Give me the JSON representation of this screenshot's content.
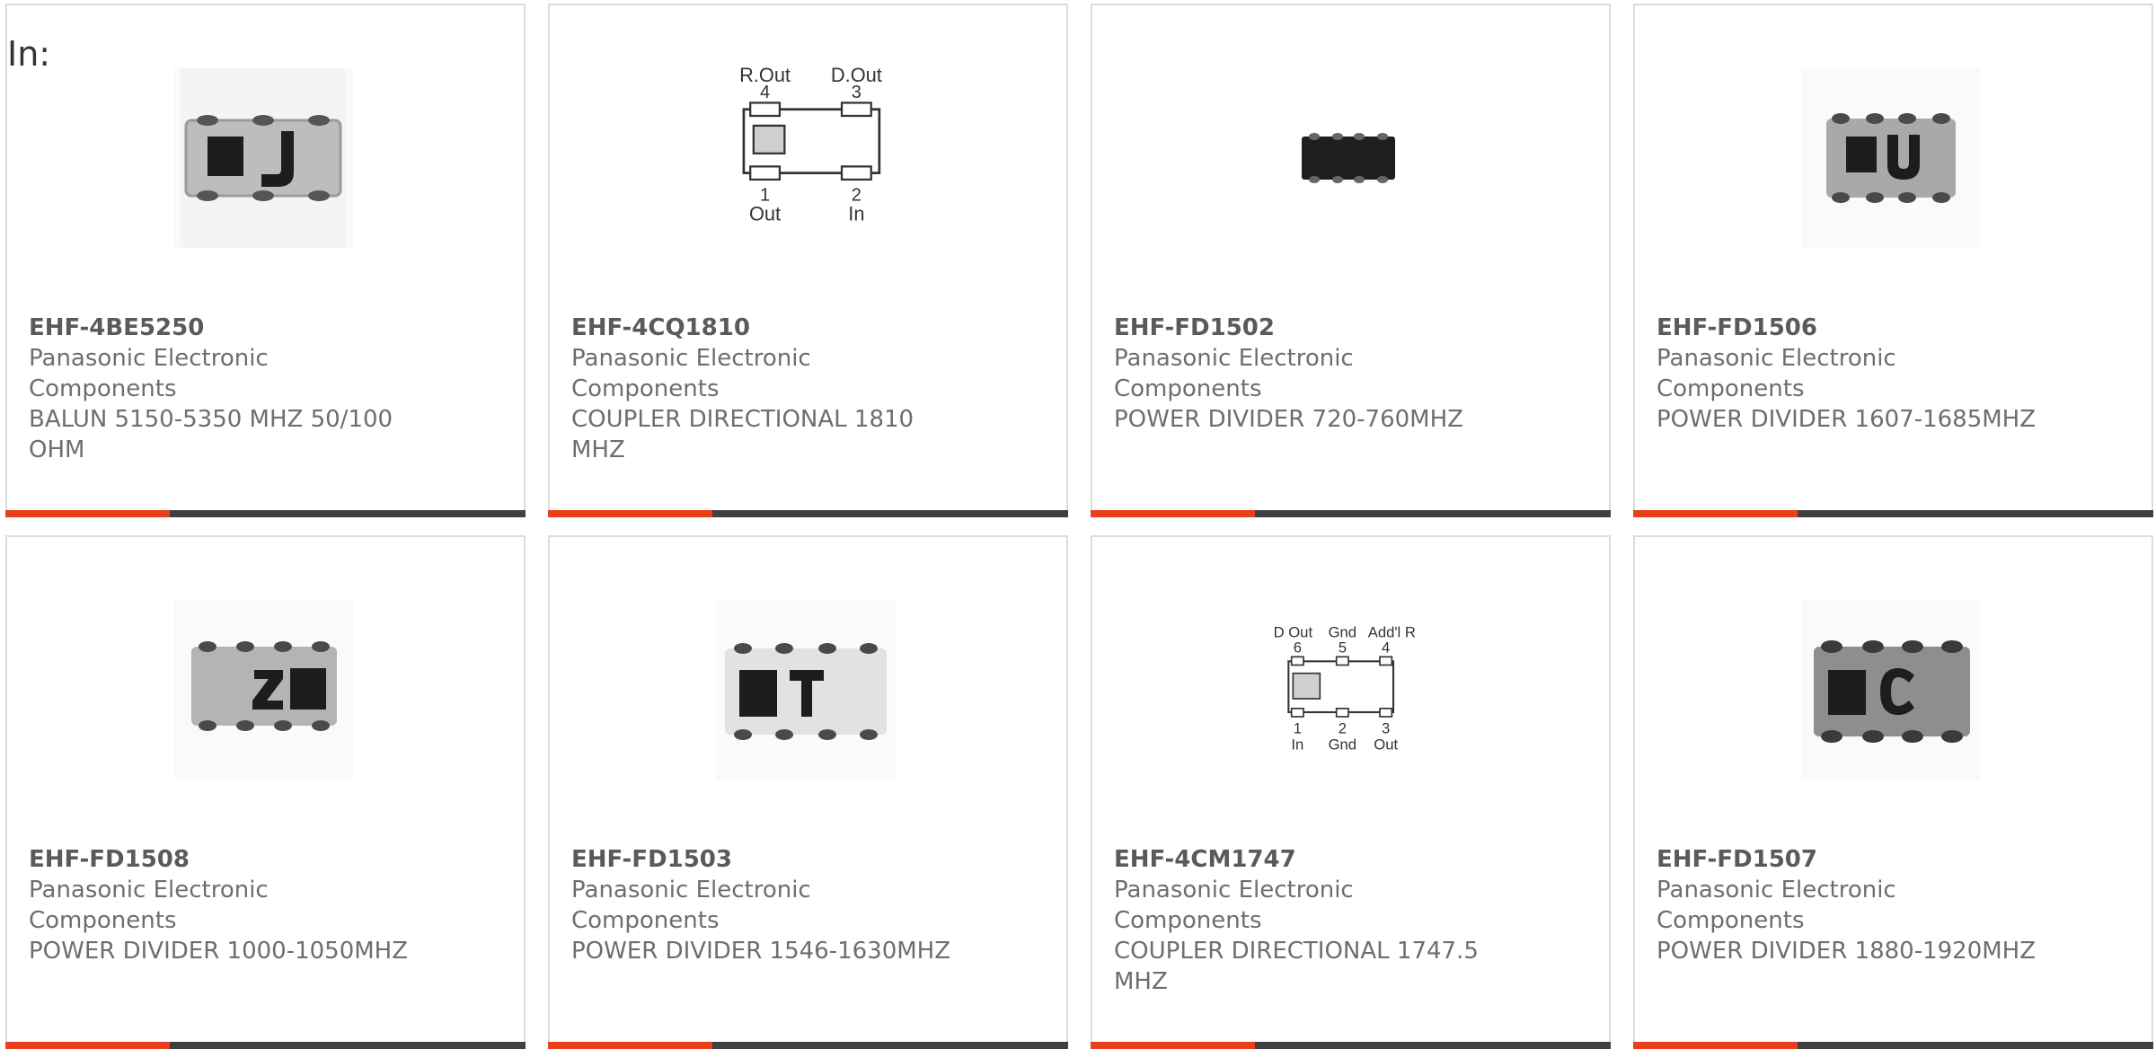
{
  "page": {
    "in_label": "In:"
  },
  "colors": {
    "accent": "#e8401c",
    "bar_rest": "#404040",
    "card_border": "#dcdcdc"
  },
  "products": [
    {
      "part": "EHF-4BE5250",
      "manufacturer": "Panasonic Electronic Components",
      "description": "BALUN 5150-5350 MHZ 50/100 OHM",
      "image": "chip-marked-J"
    },
    {
      "part": "EHF-4CQ1810",
      "manufacturer": "Panasonic Electronic Components",
      "description": "COUPLER DIRECTIONAL 1810 MHZ",
      "image": "coupler-pinout-diagram",
      "pins": {
        "p4": "4",
        "p3": "3",
        "p1": "1",
        "p2": "2",
        "l4": "R.Out",
        "l3": "D.Out",
        "l1": "Out",
        "l2": "In"
      }
    },
    {
      "part": "EHF-FD1502",
      "manufacturer": "Panasonic Electronic Components",
      "description": "POWER DIVIDER 720-760MHZ",
      "image": "chip-black"
    },
    {
      "part": "EHF-FD1506",
      "manufacturer": "Panasonic Electronic Components",
      "description": "POWER DIVIDER 1607-1685MHZ",
      "image": "chip-marked-U"
    },
    {
      "part": "EHF-FD1508",
      "manufacturer": "Panasonic Electronic Components",
      "description": "POWER DIVIDER 1000-1050MHZ",
      "image": "chip-marked-Z"
    },
    {
      "part": "EHF-FD1503",
      "manufacturer": "Panasonic Electronic Components",
      "description": "POWER DIVIDER 1546-1630MHZ",
      "image": "chip-marked-T"
    },
    {
      "part": "EHF-4CM1747",
      "manufacturer": "Panasonic Electronic Components",
      "description": "COUPLER DIRECTIONAL 1747.5 MHZ",
      "image": "coupler-pinout-diagram",
      "pins": {
        "p6": "6",
        "p5": "5",
        "p4": "4",
        "p1": "1",
        "p2": "2",
        "p3": "3",
        "l6": "D Out",
        "l5": "Gnd",
        "l4": "Add'l R",
        "l1": "In",
        "l2": "Gnd",
        "l3": "Out"
      }
    },
    {
      "part": "EHF-FD1507",
      "manufacturer": "Panasonic Electronic Components",
      "description": "POWER DIVIDER 1880-1920MHZ",
      "image": "chip-marked-C"
    }
  ]
}
